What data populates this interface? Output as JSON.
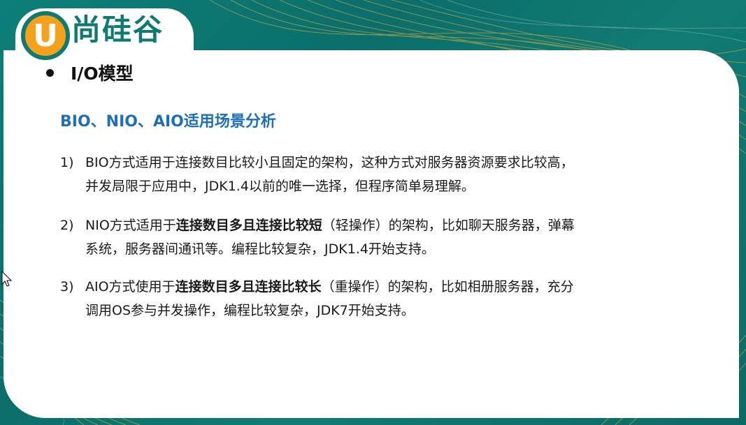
{
  "logo": {
    "mark_letter": "U",
    "brand_text": "尚硅谷",
    "colors": {
      "teal": "#0f7a72",
      "orange": "#f4a11d"
    }
  },
  "slide": {
    "heading": "I/O模型",
    "subheading": "BIO、NIO、AIO适用场景分析",
    "items": [
      {
        "num": "1)",
        "line1": "BIO方式适用于连接数目比较小且固定的架构，这种方式对服务器资源要求比较高，",
        "line2": "并发局限于应用中，JDK1.4以前的唯一选择，但程序简单易理解。"
      },
      {
        "num": "2)",
        "pre": "NIO方式适用于",
        "bold": "连接数目多且连接比较短",
        "post": "（轻操作）的架构，比如聊天服务器，弹幕",
        "line2": "系统，服务器间通讯等。编程比较复杂，JDK1.4开始支持。"
      },
      {
        "num": "3)",
        "pre": "AIO方式使用于",
        "bold": "连接数目多且连接比较长",
        "post": "（重操作）的架构，比如相册服务器，充分",
        "line2": "调用OS参与并发操作，编程比较复杂，JDK7开始支持。"
      }
    ],
    "colors": {
      "subheading": "#1f6fb8",
      "background": "#0d7f78"
    }
  }
}
